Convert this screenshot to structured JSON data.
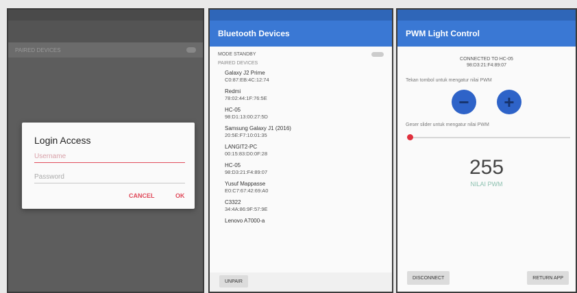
{
  "login_screen": {
    "subbar_label": "PAIRED DEVICES",
    "dialog": {
      "title": "Login Access",
      "username_placeholder": "Username",
      "password_placeholder": "Password",
      "cancel_label": "CANCEL",
      "ok_label": "OK"
    }
  },
  "devices_screen": {
    "title": "Bluetooth Devices",
    "mode_label": "MODE STANDBY",
    "section_label": "PAIRED DEVICES",
    "devices": [
      {
        "name": "Galaxy J2 Prime",
        "mac": "C0:87:EB:4C:12:74"
      },
      {
        "name": "Redmi",
        "mac": "78:02:44:1F:76:5E"
      },
      {
        "name": "HC-05",
        "mac": "98:D1:13:00:27:5D"
      },
      {
        "name": "Samsung Galaxy J1 (2016)",
        "mac": "20:5E:F7:10:01:35"
      },
      {
        "name": "LANGIT2-PC",
        "mac": "00:15:83:D0:0F:28"
      },
      {
        "name": "HC-05",
        "mac": "98:D3:21:F4:89:07"
      },
      {
        "name": "Yusuf Mappasse",
        "mac": "E0:C7:67:42:69:A0"
      },
      {
        "name": "C3322",
        "mac": "34:4A:86:9F:57:9E"
      },
      {
        "name": "Lenovo A7000-a",
        "mac": ""
      }
    ],
    "unpair_label": "UNPAIR"
  },
  "control_screen": {
    "title": "PWM Light Control",
    "connected_line1": "CONNECTED TO HC-05",
    "connected_line2": "98:D3:21:F4:89:07",
    "adjust_label": "Tekan tombol untuk mengatur nilai PWM",
    "slider_label": "Geser slider untuk mengatur nilai PWM",
    "minus_symbol": "−",
    "plus_symbol": "+",
    "pwm_value": "255",
    "pwm_label": "NILAI PWM",
    "slider_fraction": 0.0,
    "disconnect_label": "DISCONNECT",
    "return_label": "RETURN APP"
  }
}
